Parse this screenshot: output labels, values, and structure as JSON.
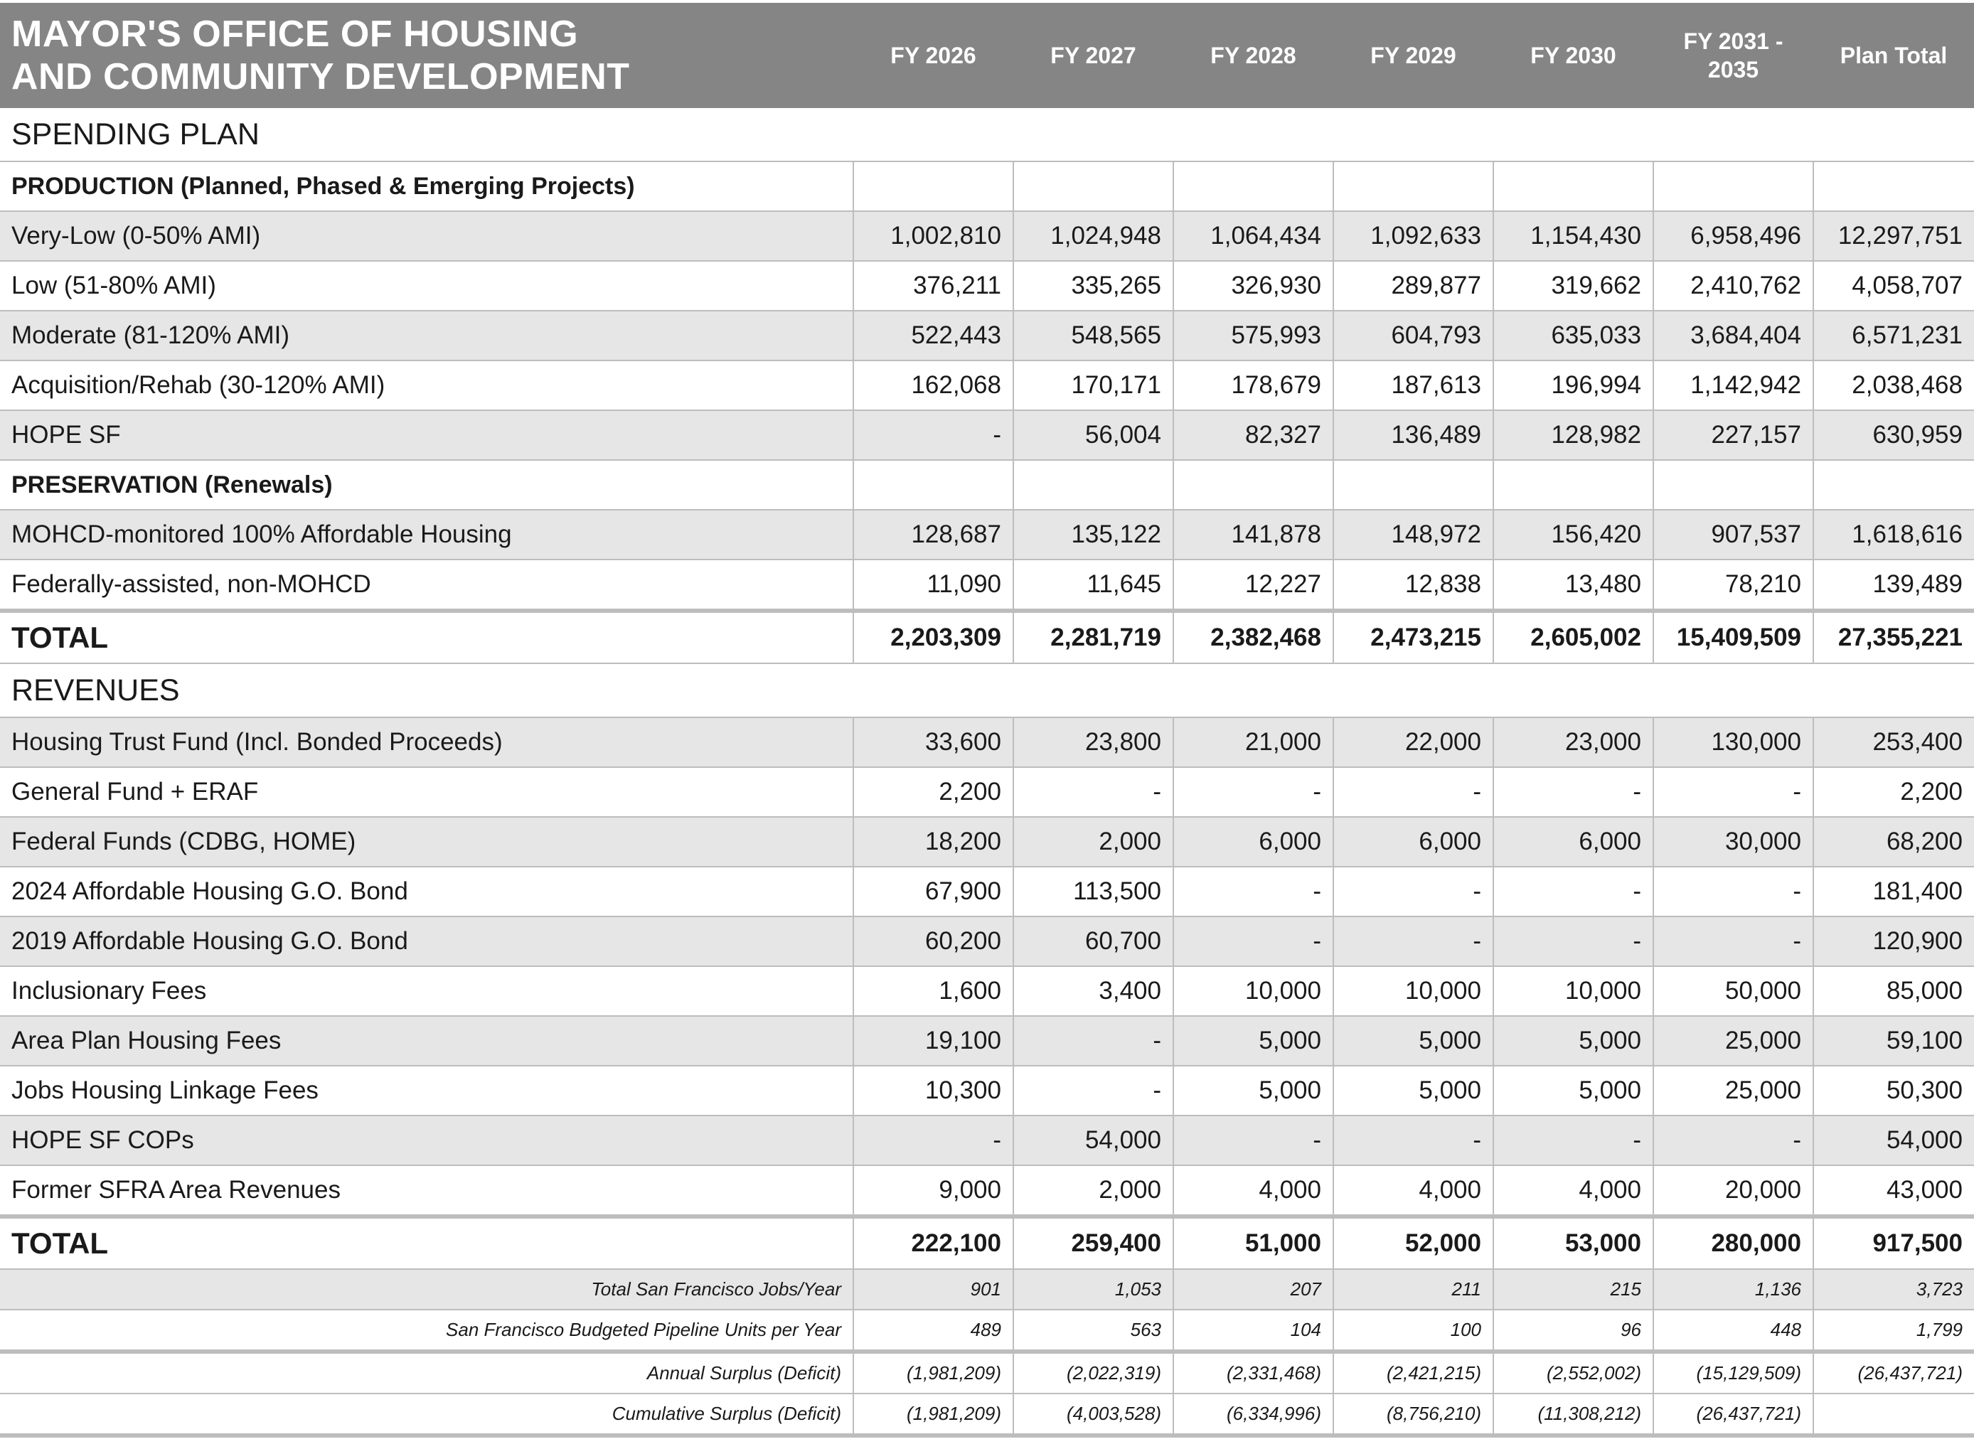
{
  "header": {
    "title_line1": "MAYOR'S OFFICE OF HOUSING",
    "title_line2": "AND COMMUNITY DEVELOPMENT",
    "columns": [
      "FY 2026",
      "FY 2027",
      "FY 2028",
      "FY 2029",
      "FY 2030",
      "FY 2031 -\n2035",
      "Plan Total"
    ]
  },
  "spending": {
    "section_title": "SPENDING PLAN",
    "production_title": "PRODUCTION (Planned, Phased & Emerging Projects)",
    "production_rows": [
      {
        "label": "Very-Low (0-50% AMI)",
        "values": [
          "1,002,810",
          "1,024,948",
          "1,064,434",
          "1,092,633",
          "1,154,430",
          "6,958,496",
          "12,297,751"
        ]
      },
      {
        "label": "Low (51-80% AMI)",
        "values": [
          "376,211",
          "335,265",
          "326,930",
          "289,877",
          "319,662",
          "2,410,762",
          "4,058,707"
        ]
      },
      {
        "label": "Moderate (81-120% AMI)",
        "values": [
          "522,443",
          "548,565",
          "575,993",
          "604,793",
          "635,033",
          "3,684,404",
          "6,571,231"
        ]
      },
      {
        "label": "Acquisition/Rehab (30-120% AMI)",
        "values": [
          "162,068",
          "170,171",
          "178,679",
          "187,613",
          "196,994",
          "1,142,942",
          "2,038,468"
        ]
      },
      {
        "label": "HOPE SF",
        "values": [
          "-",
          "56,004",
          "82,327",
          "136,489",
          "128,982",
          "227,157",
          "630,959"
        ]
      }
    ],
    "preservation_title": "PRESERVATION (Renewals)",
    "preservation_rows": [
      {
        "label": "MOHCD-monitored 100% Affordable Housing",
        "values": [
          "128,687",
          "135,122",
          "141,878",
          "148,972",
          "156,420",
          "907,537",
          "1,618,616"
        ]
      },
      {
        "label": "Federally-assisted, non-MOHCD",
        "values": [
          "11,090",
          "11,645",
          "12,227",
          "12,838",
          "13,480",
          "78,210",
          "139,489"
        ]
      }
    ],
    "total": {
      "label": "TOTAL",
      "values": [
        "2,203,309",
        "2,281,719",
        "2,382,468",
        "2,473,215",
        "2,605,002",
        "15,409,509",
        "27,355,221"
      ]
    }
  },
  "revenues": {
    "section_title": "REVENUES",
    "rows": [
      {
        "label": "Housing Trust Fund (Incl. Bonded Proceeds)",
        "values": [
          "33,600",
          "23,800",
          "21,000",
          "22,000",
          "23,000",
          "130,000",
          "253,400"
        ]
      },
      {
        "label": "General Fund + ERAF",
        "values": [
          "2,200",
          "-",
          "-",
          "-",
          "-",
          "-",
          "2,200"
        ]
      },
      {
        "label": "Federal Funds (CDBG, HOME)",
        "values": [
          "18,200",
          "2,000",
          "6,000",
          "6,000",
          "6,000",
          "30,000",
          "68,200"
        ]
      },
      {
        "label": "2024 Affordable Housing G.O. Bond",
        "values": [
          "67,900",
          "113,500",
          "-",
          "-",
          "-",
          "-",
          "181,400"
        ]
      },
      {
        "label": "2019 Affordable Housing G.O. Bond",
        "values": [
          "60,200",
          "60,700",
          "-",
          "-",
          "-",
          "-",
          "120,900"
        ]
      },
      {
        "label": "Inclusionary Fees",
        "values": [
          "1,600",
          "3,400",
          "10,000",
          "10,000",
          "10,000",
          "50,000",
          "85,000"
        ]
      },
      {
        "label": "Area Plan Housing Fees",
        "values": [
          "19,100",
          "-",
          "5,000",
          "5,000",
          "5,000",
          "25,000",
          "59,100"
        ]
      },
      {
        "label": "Jobs Housing Linkage Fees",
        "values": [
          "10,300",
          "-",
          "5,000",
          "5,000",
          "5,000",
          "25,000",
          "50,300"
        ]
      },
      {
        "label": "HOPE SF COPs",
        "values": [
          "-",
          "54,000",
          "-",
          "-",
          "-",
          "-",
          "54,000"
        ]
      },
      {
        "label": "Former SFRA Area Revenues",
        "values": [
          "9,000",
          "2,000",
          "4,000",
          "4,000",
          "4,000",
          "20,000",
          "43,000"
        ]
      }
    ],
    "total": {
      "label": "TOTAL",
      "values": [
        "222,100",
        "259,400",
        "51,000",
        "52,000",
        "53,000",
        "280,000",
        "917,500"
      ]
    }
  },
  "metrics": [
    {
      "label": "Total San Francisco Jobs/Year",
      "values": [
        "901",
        "1,053",
        "207",
        "211",
        "215",
        "1,136",
        "3,723"
      ]
    },
    {
      "label": "San Francisco Budgeted Pipeline Units per Year",
      "values": [
        "489",
        "563",
        "104",
        "100",
        "96",
        "448",
        "1,799"
      ]
    },
    {
      "label": "Annual Surplus (Deficit)",
      "values": [
        "(1,981,209)",
        "(2,022,319)",
        "(2,331,468)",
        "(2,421,215)",
        "(2,552,002)",
        "(15,129,509)",
        "(26,437,721)"
      ]
    },
    {
      "label": "Cumulative Surplus (Deficit)",
      "values": [
        "(1,981,209)",
        "(4,003,528)",
        "(6,334,996)",
        "(8,756,210)",
        "(11,308,212)",
        "(26,437,721)",
        ""
      ]
    }
  ]
}
